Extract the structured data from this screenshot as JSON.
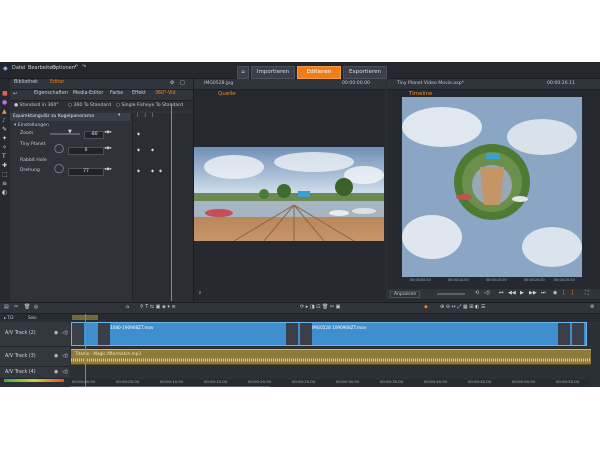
{
  "menu": [
    "Datei",
    "Bearbeiten",
    "Optionen"
  ],
  "nav": {
    "import": "Importieren",
    "edit": "Editieren",
    "export": "Exportieren"
  },
  "left_tabs": {
    "library": "Bibliothek",
    "editor": "Editor"
  },
  "editor_tabs": [
    "Eigenschaften",
    "Media-Editor",
    "Farbe",
    "Effekt",
    "360°-Vid"
  ],
  "mode_options": [
    "Standard in 360°",
    "360 To Standard",
    "Single Fisheye To Standard"
  ],
  "effect": {
    "title": "Equirektangulär zu Kugelpanorama",
    "settings_label": "Einstellungen",
    "params": [
      {
        "label": "Zoom",
        "value": "-80"
      },
      {
        "label": "Tiny Planet",
        "value": "0"
      },
      {
        "label": "Rabbit Hole",
        "value": ""
      },
      {
        "label": "Drehung",
        "value": "77"
      }
    ]
  },
  "source": {
    "filename": "IMG0528.jpg",
    "timecode": "00:00:00.00",
    "tab": "Quelle"
  },
  "timeline_preview": {
    "filename": "Tiny Planet Video Movie.axp*",
    "timecode": "00:00:26.11",
    "tab": "Timeline"
  },
  "preview_ruler": [
    "00:00:05.00",
    "00:00:10.00",
    "00:00:15.00",
    "00:00:20.00",
    "00:00:25.00"
  ],
  "aspect_select": "Anpassen",
  "timeline": {
    "solo": "Solo",
    "tracks": [
      {
        "name": "A/V Track (2)"
      },
      {
        "name": "A/V Track (3)"
      },
      {
        "name": "A/V Track (4)"
      }
    ],
    "clips": [
      {
        "name": "1080-190908ZT.mov"
      },
      {
        "name": "IMG0528 1090908ZT.mov"
      }
    ],
    "audio_clip": "Titanio - Magic Aftermatch.mp3",
    "ruler": [
      "00:00:00.00",
      "00:00:05.00",
      "00:00:10.00",
      "00:00:15.00",
      "00:00:20.00",
      "00:00:25.00",
      "00:00:30.00",
      "00:00:35.00",
      "00:00:40.00",
      "00:00:45.00",
      "00:00:50.00",
      "00:00:55.00"
    ]
  },
  "colors": {
    "accent": "#f07d1a",
    "clip": "#3f8fcf",
    "audio": "#8f7a3a"
  }
}
